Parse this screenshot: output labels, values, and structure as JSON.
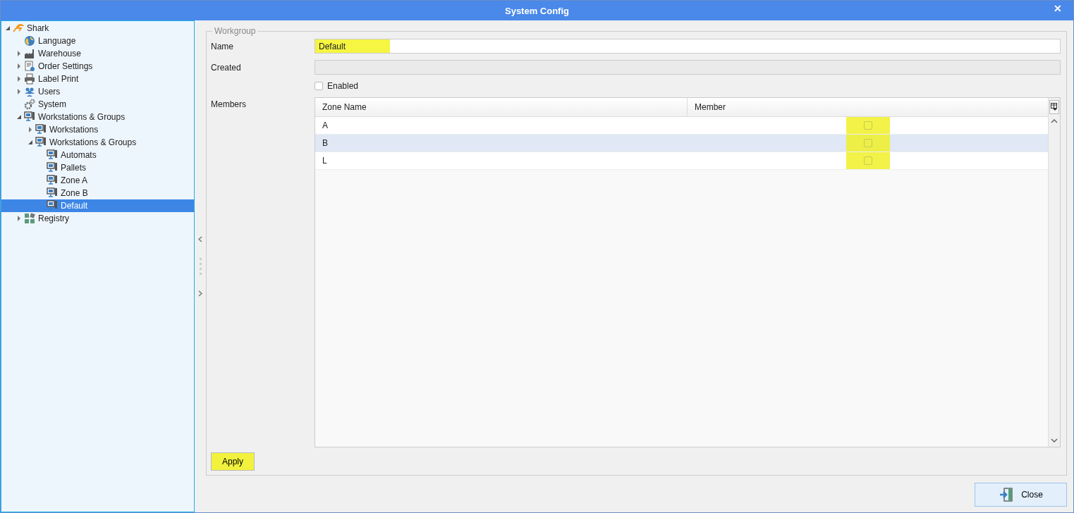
{
  "window": {
    "title": "System Config",
    "close": "✕"
  },
  "tree": [
    {
      "label": "Shark",
      "kind": "logo",
      "expanded": true,
      "selected": false,
      "children": [
        {
          "label": "Language",
          "kind": "globe",
          "selected": false
        },
        {
          "label": "Warehouse",
          "kind": "factory",
          "expanded": false,
          "selected": false
        },
        {
          "label": "Order Settings",
          "kind": "document",
          "expanded": false,
          "selected": false
        },
        {
          "label": "Label Print",
          "kind": "printer",
          "expanded": false,
          "selected": false
        },
        {
          "label": "Users",
          "kind": "users",
          "expanded": false,
          "selected": false
        },
        {
          "label": "System",
          "kind": "gears",
          "selected": false
        },
        {
          "label": "Workstations & Groups",
          "kind": "workstation",
          "expanded": true,
          "selected": false,
          "children": [
            {
              "label": "Workstations",
              "kind": "workstation",
              "expanded": false,
              "selected": false
            },
            {
              "label": "Workstations & Groups",
              "kind": "workstation",
              "expanded": true,
              "selected": false,
              "children": [
                {
                  "label": "Automats",
                  "kind": "workstation",
                  "selected": false
                },
                {
                  "label": "Pallets",
                  "kind": "workstation",
                  "selected": false
                },
                {
                  "label": "Zone A",
                  "kind": "workstation",
                  "selected": false
                },
                {
                  "label": "Zone B",
                  "kind": "workstation",
                  "selected": false
                },
                {
                  "label": "Default",
                  "kind": "workstation",
                  "selected": true
                }
              ]
            }
          ]
        },
        {
          "label": "Registry",
          "kind": "registry",
          "expanded": false,
          "selected": false
        }
      ]
    }
  ],
  "form": {
    "group_title": "Workgroup",
    "name": {
      "label": "Name",
      "value": "Default",
      "highlighted": true
    },
    "created": {
      "label": "Created"
    },
    "enabled": {
      "label": "Enabled",
      "checked": false
    },
    "members": {
      "label": "Members",
      "columns": [
        "Zone Name",
        "Member"
      ],
      "member_highlighted": true,
      "rows": [
        {
          "zone_name": "A",
          "member": false,
          "selected": false
        },
        {
          "zone_name": "B",
          "member": false,
          "selected": true
        },
        {
          "zone_name": "L",
          "member": false,
          "selected": false
        }
      ]
    },
    "apply": {
      "label": "Apply",
      "highlighted": true
    }
  },
  "footer": {
    "close": "Close"
  }
}
